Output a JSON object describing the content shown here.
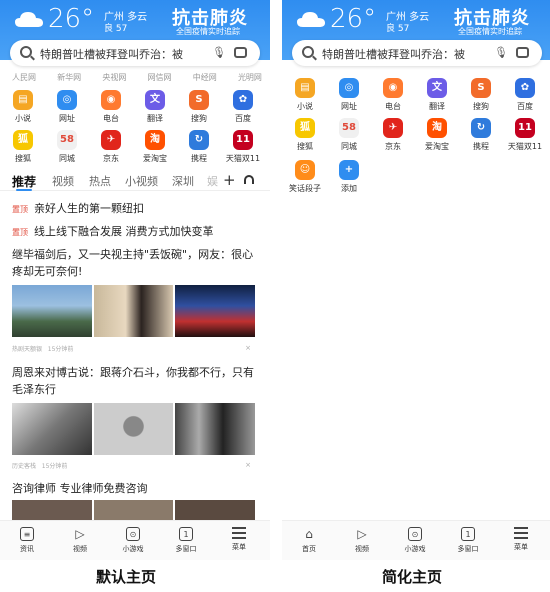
{
  "header": {
    "temperature": "26°",
    "city": "广州  多云",
    "aqi": "良 57",
    "banner_title": "抗击肺炎",
    "banner_sub": "全国疫情实时追踪"
  },
  "search": {
    "placeholder": "特朗普吐槽被拜登叫乔治：被"
  },
  "default_page": {
    "sites": [
      "人民网",
      "新华网",
      "央视网",
      "网信网",
      "中经网",
      "光明网"
    ],
    "apps_row1": [
      {
        "label": "小说",
        "icon": "book-icon",
        "color": "#f5a623"
      },
      {
        "label": "网址",
        "icon": "compass-icon",
        "color": "#2f8df0"
      },
      {
        "label": "电台",
        "icon": "radio-icon",
        "color": "#ff7a2f"
      },
      {
        "label": "翻译",
        "icon": "translate-icon",
        "color": "#6c5ce7"
      },
      {
        "label": "搜狗",
        "icon": "sogou-icon",
        "color": "#f26b2a"
      },
      {
        "label": "百度",
        "icon": "baidu-icon",
        "color": "#2f6fe0"
      }
    ],
    "apps_row2": [
      {
        "label": "搜狐",
        "icon": "sohu-icon",
        "color": "#f7c700"
      },
      {
        "label": "同城",
        "icon": "58-icon",
        "color": "#f0f0f0"
      },
      {
        "label": "京东",
        "icon": "jd-icon",
        "color": "#e1251b"
      },
      {
        "label": "爱淘宝",
        "icon": "taobao-icon",
        "color": "#ff5000"
      },
      {
        "label": "携程",
        "icon": "ctrip-icon",
        "color": "#2f7bdc"
      },
      {
        "label": "天猫双11",
        "icon": "tmall-icon",
        "color": "#c4001f"
      }
    ],
    "tabs": [
      "推荐",
      "视频",
      "热点",
      "小视频",
      "深圳",
      "娱"
    ],
    "pinned": [
      {
        "tag": "置顶",
        "text": "亲好人生的第一颗纽扣"
      },
      {
        "tag": "置顶",
        "text": "线上线下融合发展 消费方式加快变革"
      }
    ],
    "articles": [
      {
        "title": "继毕福剑后，又一央视主持\"丢饭碗\"，网友：很心疼却无可奈何!",
        "source": "热剧天额银",
        "time": "15分钟前"
      },
      {
        "title": "周恩来对博古说：跟蒋介石斗，你我都不行，只有毛泽东行",
        "source": "历史客栈",
        "time": "15分钟前"
      },
      {
        "title": "咨询律师 专业律师免费咨询",
        "source": "",
        "time": ""
      }
    ],
    "bottom_nav": [
      "资讯",
      "视频",
      "小游戏",
      "多窗口",
      "菜单"
    ],
    "caption": "默认主页"
  },
  "simple_page": {
    "apps_row1": [
      {
        "label": "小说",
        "icon": "book-icon",
        "color": "#f5a623"
      },
      {
        "label": "网址",
        "icon": "compass-icon",
        "color": "#2f8df0"
      },
      {
        "label": "电台",
        "icon": "radio-icon",
        "color": "#ff7a2f"
      },
      {
        "label": "翻译",
        "icon": "translate-icon",
        "color": "#6c5ce7"
      },
      {
        "label": "搜狗",
        "icon": "sogou-icon",
        "color": "#f26b2a"
      },
      {
        "label": "百度",
        "icon": "baidu-icon",
        "color": "#2f6fe0"
      }
    ],
    "apps_row2": [
      {
        "label": "搜狐",
        "icon": "sohu-icon",
        "color": "#f7c700"
      },
      {
        "label": "同城",
        "icon": "58-icon",
        "color": "#f0f0f0"
      },
      {
        "label": "京东",
        "icon": "jd-icon",
        "color": "#e1251b"
      },
      {
        "label": "爱淘宝",
        "icon": "taobao-icon",
        "color": "#ff5000"
      },
      {
        "label": "携程",
        "icon": "ctrip-icon",
        "color": "#2f7bdc"
      },
      {
        "label": "天猫双11",
        "icon": "tmall-icon",
        "color": "#c4001f"
      }
    ],
    "apps_row3": [
      {
        "label": "笑话段子",
        "icon": "joke-icon",
        "color": "#ff8c1a"
      },
      {
        "label": "添加",
        "icon": "add-icon",
        "color": "#2f8df0"
      }
    ],
    "bottom_nav": [
      "首页",
      "视频",
      "小游戏",
      "多窗口",
      "菜单"
    ],
    "caption": "简化主页"
  }
}
